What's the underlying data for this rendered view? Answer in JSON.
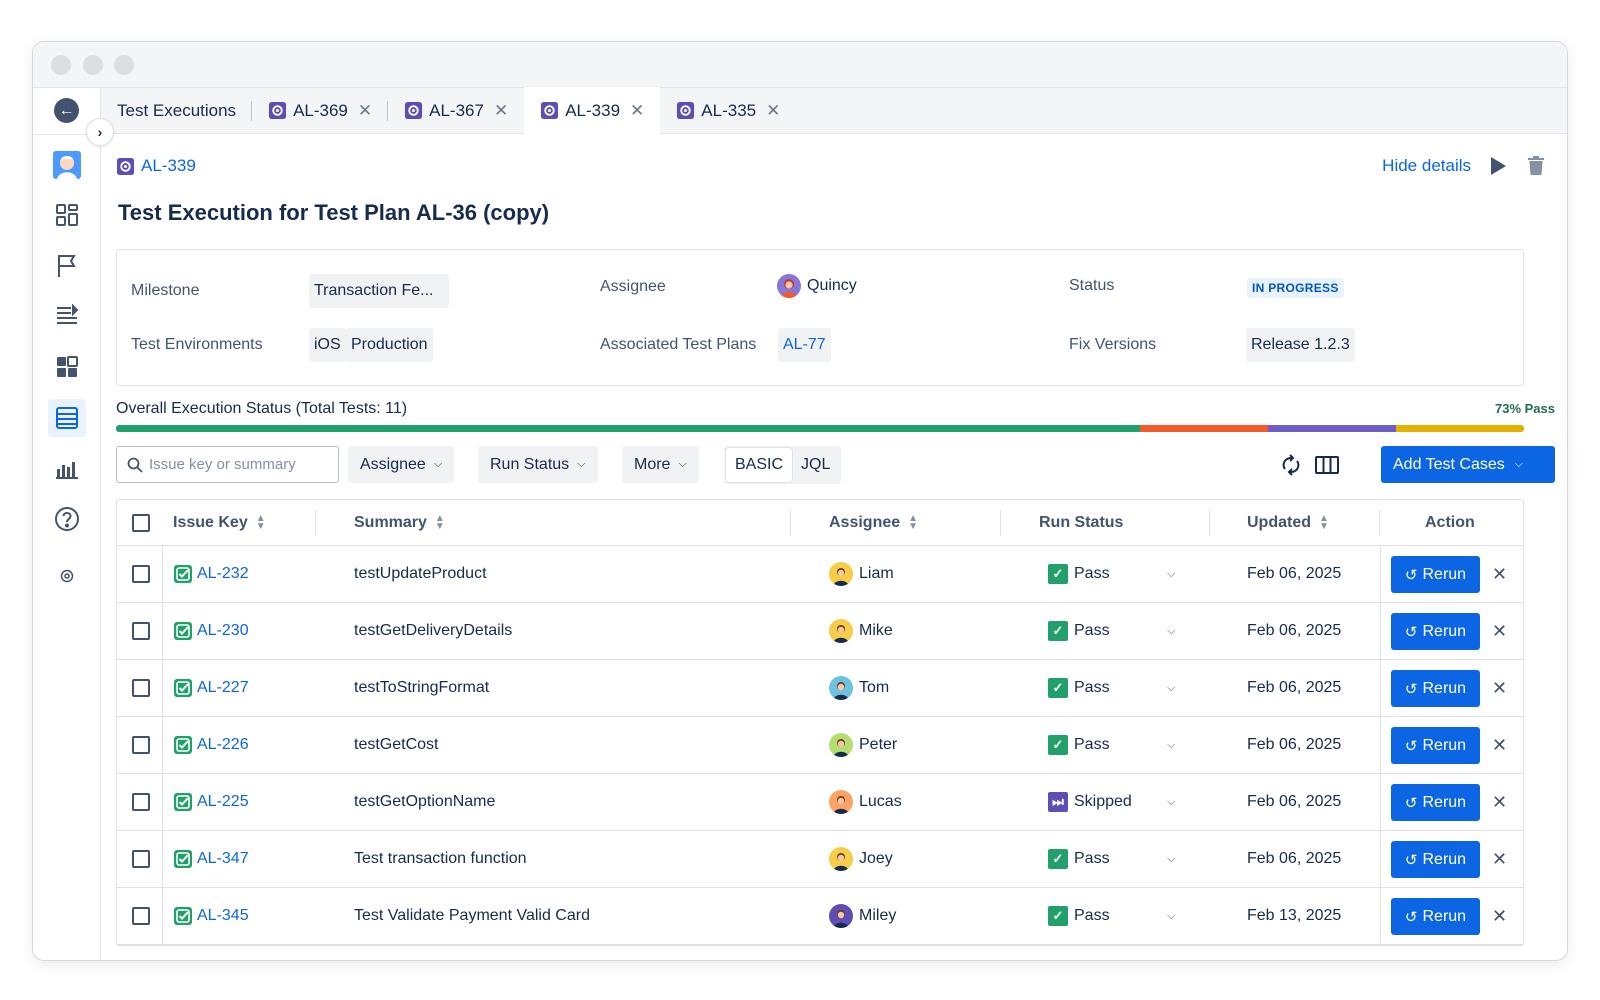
{
  "tabs": [
    {
      "label": "Test Executions",
      "icon": "",
      "closable": false,
      "active": false
    },
    {
      "label": "AL-369",
      "icon": "test-execution-icon",
      "closable": true,
      "active": false
    },
    {
      "label": "AL-367",
      "icon": "test-execution-icon",
      "closable": true,
      "active": false
    },
    {
      "label": "AL-339",
      "icon": "test-execution-icon",
      "closable": true,
      "active": true
    },
    {
      "label": "AL-335",
      "icon": "test-execution-icon",
      "closable": true,
      "active": false
    }
  ],
  "close_glyph": "✕",
  "sidebar": {
    "items": [
      "avatar-icon",
      "overview-icon",
      "flag-icon",
      "list-icon",
      "dashboard-icon",
      "test-executions-icon",
      "reports-icon",
      "help-icon",
      "settings-icon"
    ],
    "active_index": 5
  },
  "header": {
    "breadcrumb": "AL-339",
    "hide_details": "Hide details",
    "title": "Test Execution for Test Plan AL-36 (copy)"
  },
  "details": {
    "milestone_label": "Milestone",
    "milestone_value": "Transaction Fe...",
    "environments_label": "Test Environments",
    "environments": [
      "iOS",
      "Production"
    ],
    "assignee_label": "Assignee",
    "assignee_value": "Quincy",
    "test_plans_label": "Associated Test Plans",
    "test_plans_value": "AL-77",
    "status_label": "Status",
    "status_value": "IN PROGRESS",
    "fix_versions_label": "Fix Versions",
    "fix_versions_value": "Release 1.2.3"
  },
  "progress": {
    "label": "Overall Execution Status (Total Tests: 11)",
    "pass_text": "73% Pass",
    "segments": [
      {
        "fraction": 0.727,
        "color": "#22A06B"
      },
      {
        "fraction": 0.091,
        "color": "#F15B29"
      },
      {
        "fraction": 0.091,
        "color": "#6E5DC6"
      },
      {
        "fraction": 0.091,
        "color": "#E2B203"
      }
    ]
  },
  "toolbar": {
    "search_placeholder": "Issue key or summary",
    "filters": [
      "Assignee",
      "Run Status",
      "More"
    ],
    "modes": [
      "BASIC",
      "JQL"
    ],
    "active_mode": "BASIC",
    "add_button": "Add Test Cases"
  },
  "table": {
    "columns": [
      "Issue Key",
      "Summary",
      "Assignee",
      "Run Status",
      "Updated",
      "Action"
    ],
    "rerun_label": "Rerun",
    "rows": [
      {
        "key": "AL-232",
        "summary": "testUpdateProduct",
        "assignee": "Liam",
        "avatar_color": "#F5CD47",
        "status": "Pass",
        "updated": "Feb 06, 2025"
      },
      {
        "key": "AL-230",
        "summary": "testGetDeliveryDetails",
        "assignee": "Mike",
        "avatar_color": "#F5CD47",
        "status": "Pass",
        "updated": "Feb 06, 2025"
      },
      {
        "key": "AL-227",
        "summary": "testToStringFormat",
        "assignee": "Tom",
        "avatar_color": "#6CC3E0",
        "status": "Pass",
        "updated": "Feb 06, 2025"
      },
      {
        "key": "AL-226",
        "summary": "testGetCost",
        "assignee": "Peter",
        "avatar_color": "#B3DF72",
        "status": "Pass",
        "updated": "Feb 06, 2025"
      },
      {
        "key": "AL-225",
        "summary": "testGetOptionName",
        "assignee": "Lucas",
        "avatar_color": "#FEA362",
        "status": "Skipped",
        "updated": "Feb 06, 2025"
      },
      {
        "key": "AL-347",
        "summary": "Test transaction function",
        "assignee": "Joey",
        "avatar_color": "#F5CD47",
        "status": "Pass",
        "updated": "Feb 06, 2025"
      },
      {
        "key": "AL-345",
        "summary": "Test Validate Payment Valid Card",
        "assignee": "Miley",
        "avatar_color": "#5E4DB2",
        "status": "Pass",
        "updated": "Feb 13, 2025"
      }
    ]
  },
  "colors": {
    "primary": "#0C66E4",
    "pass": "#22A06B",
    "skipped": "#5E4DB2"
  }
}
